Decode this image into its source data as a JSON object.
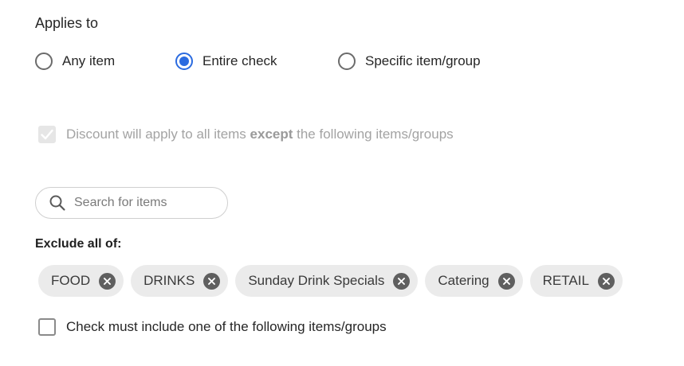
{
  "section": {
    "title": "Applies to"
  },
  "applies_to": {
    "options": [
      {
        "label": "Any item",
        "selected": false
      },
      {
        "label": "Entire check",
        "selected": true
      },
      {
        "label": "Specific item/group",
        "selected": false
      }
    ]
  },
  "discount_scope": {
    "checked": true,
    "disabled": true,
    "text_before": "Discount will apply to all items ",
    "text_bold": "except",
    "text_after": " the following items/groups"
  },
  "search": {
    "placeholder": "Search for items",
    "value": ""
  },
  "exclude": {
    "label": "Exclude all of:",
    "chips": [
      "FOOD",
      "DRINKS",
      "Sunday Drink Specials",
      "Catering",
      "RETAIL"
    ]
  },
  "include_requirement": {
    "checked": false,
    "label": "Check must include one of the following items/groups"
  },
  "colors": {
    "accent": "#2b6be0",
    "chip_bg": "#ebebeb",
    "chip_remove_bg": "#5f5f5f",
    "disabled_text": "#a3a3a3"
  },
  "icons": {
    "search": "search-icon",
    "chip_remove": "close-circle-icon",
    "checkmark": "checkmark-icon"
  }
}
